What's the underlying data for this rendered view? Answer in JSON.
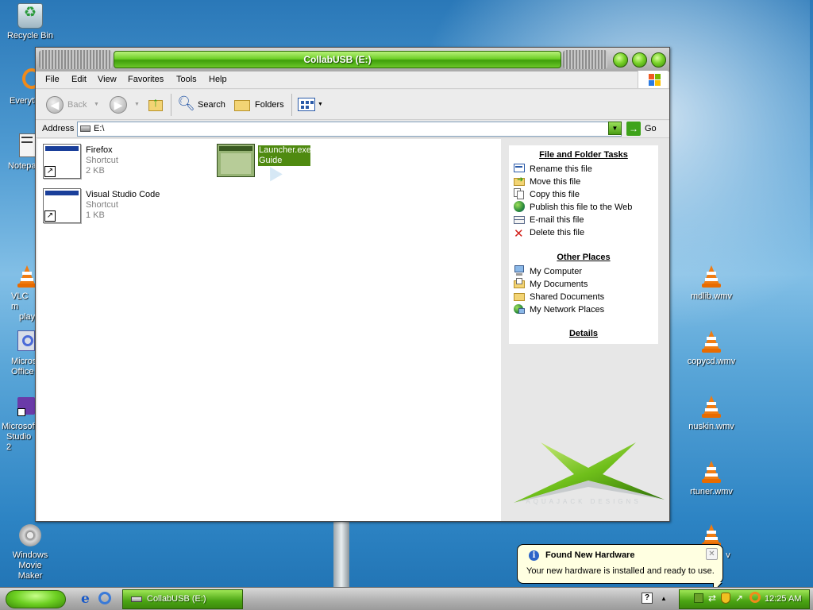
{
  "desktop": {
    "icons": [
      {
        "label": "Recycle Bin"
      },
      {
        "label": "Everyth"
      },
      {
        "label": "Notepa"
      },
      {
        "label_line1": "VLC m",
        "label_line2": "play"
      },
      {
        "label_line1": "Micros",
        "label_line2": "Office"
      },
      {
        "label_line1": "Microsoft",
        "label_line2": "Studio 2"
      },
      {
        "label_line1": "Windows Movie",
        "label_line2": "Maker"
      }
    ],
    "media_files": [
      {
        "label": "mdlib.wmv"
      },
      {
        "label": "copycd.wmv"
      },
      {
        "label": "nuskin.wmv"
      },
      {
        "label": "rtuner.wmv"
      },
      {
        "label": "v"
      }
    ]
  },
  "window": {
    "title": "CollabUSB (E:)",
    "menu": [
      "File",
      "Edit",
      "View",
      "Favorites",
      "Tools",
      "Help"
    ],
    "toolbar": {
      "back_label": "Back",
      "search_label": "Search",
      "folders_label": "Folders"
    },
    "address": {
      "label": "Address",
      "value": "E:\\",
      "go_label": "Go"
    },
    "files": [
      {
        "name": "Firefox",
        "type": "Shortcut",
        "size": "2 KB"
      },
      {
        "name": "Visual Studio Code",
        "type": "Shortcut",
        "size": "1 KB"
      },
      {
        "name": "Launcher.exe",
        "type": "Guide",
        "selected": true
      }
    ],
    "side_pane": {
      "file_tasks_title": "File and Folder Tasks",
      "file_tasks": [
        {
          "label": "Rename this file",
          "icon": "rename-icon"
        },
        {
          "label": "Move this file",
          "icon": "move-icon"
        },
        {
          "label": "Copy this file",
          "icon": "copy-icon"
        },
        {
          "label": "Publish this file to the Web",
          "icon": "globe-icon"
        },
        {
          "label": "E-mail this file",
          "icon": "mail-icon"
        },
        {
          "label": "Delete this file",
          "icon": "delete-icon"
        }
      ],
      "other_places_title": "Other Places",
      "other_places": [
        {
          "label": "My Computer",
          "icon": "computer-icon"
        },
        {
          "label": "My Documents",
          "icon": "documents-icon"
        },
        {
          "label": "Shared Documents",
          "icon": "folder-icon"
        },
        {
          "label": "My Network Places",
          "icon": "network-icon"
        }
      ],
      "details_title": "Details",
      "brand_text": "AQUAJACK DESIGNS"
    }
  },
  "notification": {
    "title": "Found New Hardware",
    "text": "Your new hardware is installed and ready to use."
  },
  "taskbar": {
    "task_label": "CollabUSB (E:)",
    "clock": "12:25 AM"
  },
  "colors": {
    "accent_green": "#4aa413",
    "selection_green": "#4f8a10",
    "desktop_blue": "#2a78b8"
  }
}
